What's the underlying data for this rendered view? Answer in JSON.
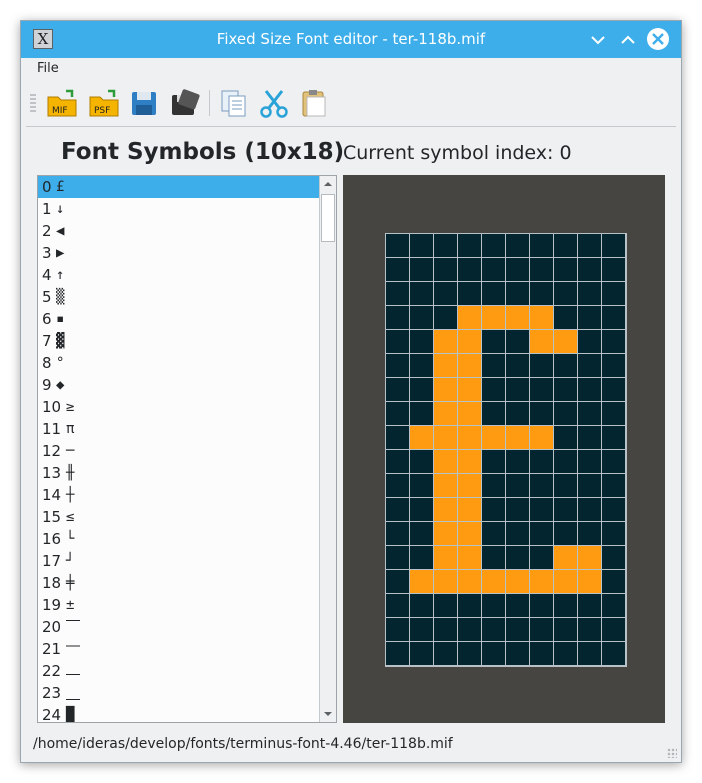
{
  "window": {
    "title": "Fixed Size Font editor - ter-118b.mif",
    "app_icon": "X",
    "minimize_icon": "chevron-down-icon",
    "maximize_icon": "chevron-up-icon",
    "close_icon": "close-icon"
  },
  "menu": {
    "file_label": "File"
  },
  "toolbar": {
    "items": [
      {
        "name": "open-mif",
        "label": "MIF",
        "color": "#f5b400"
      },
      {
        "name": "open-psf",
        "label": "PSF",
        "color": "#f5b400"
      },
      {
        "name": "save",
        "label": ""
      },
      {
        "name": "save-as",
        "label": ""
      },
      {
        "name": "copy",
        "label": ""
      },
      {
        "name": "cut",
        "label": ""
      },
      {
        "name": "paste",
        "label": ""
      }
    ]
  },
  "headings": {
    "symbols": "Font Symbols (10x18)",
    "current": "Current symbol index: 0"
  },
  "symbols": [
    {
      "index": "0",
      "glyph": "£"
    },
    {
      "index": "1",
      "glyph": "↓"
    },
    {
      "index": "2",
      "glyph": "◀"
    },
    {
      "index": "3",
      "glyph": "▶"
    },
    {
      "index": "4",
      "glyph": "↑"
    },
    {
      "index": "5",
      "glyph": "▒"
    },
    {
      "index": "6",
      "glyph": "▪"
    },
    {
      "index": "7",
      "glyph": "▓"
    },
    {
      "index": "8",
      "glyph": "°"
    },
    {
      "index": "9",
      "glyph": "◆"
    },
    {
      "index": "10",
      "glyph": "≥"
    },
    {
      "index": "11",
      "glyph": "π"
    },
    {
      "index": "12",
      "glyph": "─"
    },
    {
      "index": "13",
      "glyph": "╫"
    },
    {
      "index": "14",
      "glyph": "┼"
    },
    {
      "index": "15",
      "glyph": "≤"
    },
    {
      "index": "16",
      "glyph": "└"
    },
    {
      "index": "17",
      "glyph": "┘"
    },
    {
      "index": "18",
      "glyph": "╪"
    },
    {
      "index": "19",
      "glyph": "±"
    },
    {
      "index": "20",
      "glyph": "⎺"
    },
    {
      "index": "21",
      "glyph": "⎻"
    },
    {
      "index": "22",
      "glyph": "⎼"
    },
    {
      "index": "23",
      "glyph": "⎽"
    },
    {
      "index": "24",
      "glyph": "█"
    }
  ],
  "selected_index": 0,
  "glyph_bitmap": {
    "cols": 10,
    "rows": 18,
    "on_color": "#ff9b10",
    "off_color": "#03252f",
    "pixels": [
      "..........",
      "..........",
      "..........",
      "...####...",
      "..##..##..",
      "..##......",
      "..##......",
      "..##......",
      ".######...",
      "..##......",
      "..##......",
      "..##......",
      "..##......",
      "..##...##.",
      ".########.",
      "..........",
      "..........",
      ".........."
    ]
  },
  "status": {
    "path": "/home/ideras/develop/fonts/terminus-font-4.46/ter-118b.mif"
  }
}
